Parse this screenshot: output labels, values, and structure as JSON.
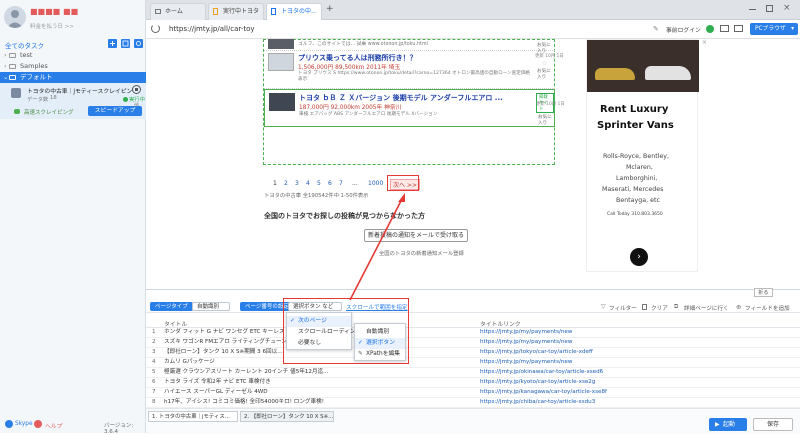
{
  "sidebar": {
    "username": "■■■■ ■■",
    "subtitle": "料金を払う日 >>",
    "all_tasks": "全てのタスク",
    "folders": [
      "test",
      "Samples",
      "デフォルト"
    ],
    "task": {
      "title": "トヨタの中古車｜jモティースクレイピン",
      "data_label": "データ数",
      "data_count": "18",
      "status": "実行中",
      "status_sub": "他",
      "cloud_label": "高速スクレイピング",
      "speedup_button": "スピードアップ"
    },
    "footer": {
      "skype": "Skype",
      "help": "ヘルプ",
      "version": "バージョン: 3.6.4"
    }
  },
  "browser": {
    "tabs": [
      "ホーム",
      "実行中トヨタ",
      "トヨタの中..."
    ],
    "new_tab": "+",
    "url": "https://jmty.jp/all/car-toy",
    "login": "事前ログイン",
    "pc_browser": "PCブラウザ",
    "accent": "#2a7ee8"
  },
  "page": {
    "listings": [
      {
        "title": "",
        "price": "",
        "desc": "ゴルフ、このサイトでは... 試乗 www.otonon.jp/toku.html",
        "side1": "",
        "side2": "お気に入り"
      },
      {
        "title": "プリウス乗ってる人は刑務所行き！？",
        "price": "1,506,000円 89,500km 2011年 埼玉",
        "desc": "トヨタ プリウス S https://www.otonon.jp/toku/detail?carno=127364 オトロン最高値の自動ローン査定価格表示",
        "side1": "更新 10月 1日",
        "side2": "お気に入り"
      },
      {
        "title": "トヨタ ｂＢ Ｚ Ｘバージョン 後期モデル アンダーフルエアロ ...",
        "price": "187,000円 92,000km 2005年 神奈川",
        "desc": "車検 エアバッグ ABS アンダーフルエアロ 後期モデル Xバージョン",
        "side1": "更新 10月 1日",
        "side2": "お気に入り",
        "badge": "掲載サイト"
      }
    ],
    "pagination": [
      "1",
      "2",
      "3",
      "4",
      "5",
      "6",
      "7",
      "...",
      "1000"
    ],
    "next_page": "次へ >>",
    "result_count": "トヨタの中古車 全190542件中 1-50件表示",
    "not_found": "全国のトヨタでお探しの投稿が見つからなかった方",
    "notify_button": "新着投稿の通知をメールで受け取る",
    "notify_sub": "全国のトヨタの新着通知メール登録",
    "ad": {
      "line1": "Rent Luxury",
      "line2": "Sprinter Vans",
      "brands": [
        "Rolls-Royce, Bentley,",
        "Mclaren,",
        "Lamborghini,",
        "Maserati, Mercedes",
        "Bentayga, etc"
      ],
      "contact": "Call Today 310.803.3650"
    }
  },
  "panel": {
    "page_type_label": "ページタイプ",
    "page_type_value": "自動識別",
    "paging_label": "ページ番号の設定",
    "paging_value": "選択ボタン など",
    "scroll_label": "スクロールで範囲を指定",
    "filter": "フィルター",
    "clear": "クリア",
    "detail": "詳細ページに行く",
    "add_field": "フィールドを追加",
    "collapse": "折る",
    "columns": [
      "タイトル",
      "タイトルリンク"
    ],
    "rows": [
      {
        "n": "1",
        "title": "ホンダ フィット G ナビ ワンセグ ETC キーレス",
        "url": "https://jmty.jp/my/payments/new"
      },
      {
        "n": "2",
        "title": "スズキ ワゴンR FMエアロ ライティングチューンブ...",
        "url": "https://jmty.jp/my/payments/new"
      },
      {
        "n": "3",
        "title": "【即社ローン】タンク 10 X S※期間 3 6回以...",
        "url": "https://jmty.jp/tokyo/car-toy/article-xdeff"
      },
      {
        "n": "4",
        "title": "カムリ Gパッケージ",
        "url": "https://jmty.jp/my/payments/new"
      },
      {
        "n": "5",
        "title": "極厳選 クラウンアスリート カーレント 20インチ 値5年12月迄...",
        "url": "https://jmty.jp/okinawa/car-toy/article-xsed6"
      },
      {
        "n": "6",
        "title": "トヨタ ライズ 令和2年 ナビ ETC 車検付き",
        "url": "https://jmty.jp/kyoto/car-toy/article-xse2g"
      },
      {
        "n": "7",
        "title": "ハイエース スーパーGL ディーゼル 4WD",
        "url": "https://jmty.jp/kanagawa/car-toy/article-xse8f"
      },
      {
        "n": "8",
        "title": "h17年、アイシス! コミコミ価格! 全印54000キロ! ロング車検!",
        "url": "https://jmty.jp/chiba/car-toy/article-xsdu3"
      }
    ],
    "paging_menu": [
      "次のページ",
      "スクロールローディング",
      "必要なし"
    ],
    "sub_menu": [
      "自動識別",
      "選択ボタン",
      "XPathを編集"
    ],
    "bottom_tabs": [
      "1. トヨタの中古車｜jモティス...",
      "2. 【即社ローン】タンク 10 X S※..."
    ],
    "start": "起動",
    "save": "保存"
  }
}
